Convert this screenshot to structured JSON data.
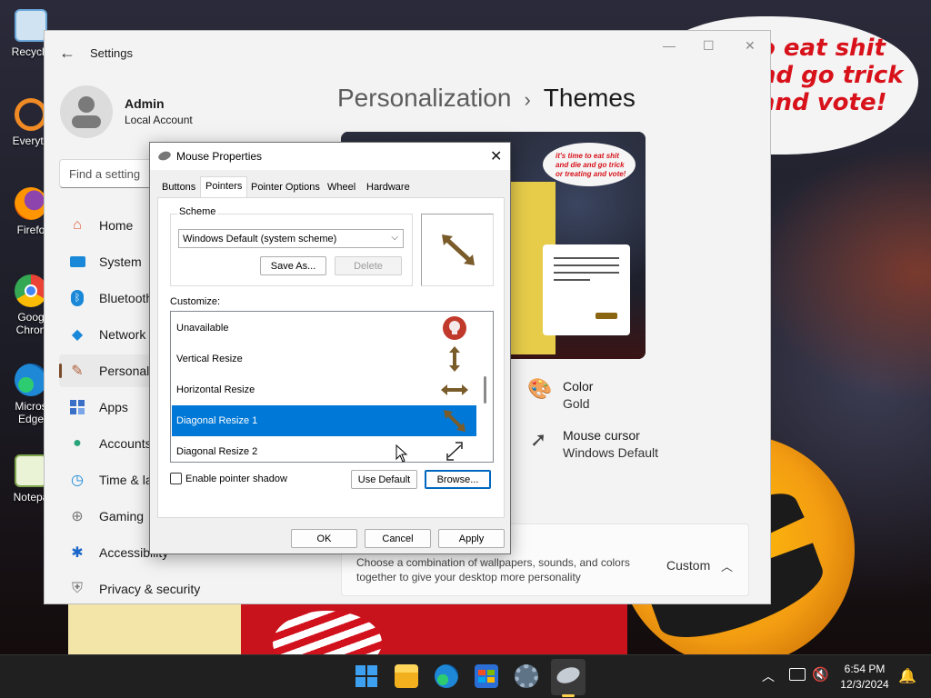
{
  "desktop": {
    "speech_bubble_text": "o eat shit\nnd go trick\nand vote!",
    "icons": [
      {
        "label": "Recycle",
        "name": "recycle-bin-icon",
        "color": "#6aa6d8"
      },
      {
        "label": "Everyth",
        "name": "everything-search-icon",
        "color": "#f08a24"
      },
      {
        "label": "Firefo",
        "name": "firefox-icon",
        "color": "#e66000"
      },
      {
        "label": "Goog\nChron",
        "name": "google-chrome-icon",
        "color": "#34a853"
      },
      {
        "label": "Micros\nEdge",
        "name": "microsoft-edge-icon",
        "color": "#1e88d6"
      },
      {
        "label": "Notepa",
        "name": "notepad-icon",
        "color": "#b8d68c"
      }
    ]
  },
  "settings": {
    "title": "Settings",
    "profile": {
      "name": "Admin",
      "type": "Local Account"
    },
    "search_placeholder": "Find a setting",
    "nav": [
      {
        "label": "Home",
        "icon": "home-icon",
        "color": "#e06040"
      },
      {
        "label": "System",
        "icon": "system-icon",
        "color": "#1a88d8"
      },
      {
        "label": "Bluetooth",
        "icon": "bluetooth-icon",
        "color": "#1a88d8"
      },
      {
        "label": "Network",
        "icon": "network-icon",
        "color": "#1a88d8"
      },
      {
        "label": "Personali",
        "icon": "personalization-icon",
        "color": "#b0623a"
      },
      {
        "label": "Apps",
        "icon": "apps-icon",
        "color": "#3a6fc8"
      },
      {
        "label": "Accounts",
        "icon": "accounts-icon",
        "color": "#2aa37a"
      },
      {
        "label": "Time & la",
        "icon": "time-language-icon",
        "color": "#1a88d8"
      },
      {
        "label": "Gaming",
        "icon": "gaming-icon",
        "color": "#7a7a7a"
      },
      {
        "label": "Accessibility",
        "icon": "accessibility-icon",
        "color": "#1a66c8"
      },
      {
        "label": "Privacy & security",
        "icon": "privacy-shield-icon",
        "color": "#7a7a7a"
      }
    ],
    "breadcrumb": {
      "parent": "Personalization",
      "separator": "›",
      "current": "Themes"
    },
    "preview_bubble_text": "it's time to eat shit\nand die and go trick\nor treating and vote!",
    "color": {
      "label": "Color",
      "value": "Gold"
    },
    "mouse_cursor": {
      "label": "Mouse cursor",
      "value": "Windows Default"
    },
    "current_theme": {
      "description": "Choose a combination of wallpapers, sounds, and colors together to give your desktop more personality",
      "value": "Custom"
    }
  },
  "dialog": {
    "title": "Mouse Properties",
    "close_label": "✕",
    "tabs": [
      "Buttons",
      "Pointers",
      "Pointer Options",
      "Wheel",
      "Hardware"
    ],
    "active_tab": "Pointers",
    "scheme_label": "Scheme",
    "scheme_value": "Windows Default (system scheme)",
    "save_as_label": "Save As...",
    "delete_label": "Delete",
    "customize_label": "Customize:",
    "cursors": [
      {
        "label": "Unavailable",
        "icon": "unavailable-cursor-icon"
      },
      {
        "label": "Vertical Resize",
        "icon": "vertical-resize-cursor-icon"
      },
      {
        "label": "Horizontal Resize",
        "icon": "horizontal-resize-cursor-icon"
      },
      {
        "label": "Diagonal Resize 1",
        "icon": "diagonal-resize-1-cursor-icon"
      },
      {
        "label": "Diagonal Resize 2",
        "icon": "diagonal-resize-2-cursor-icon"
      }
    ],
    "selected_cursor": "Diagonal Resize 1",
    "shadow_label": "Enable pointer shadow",
    "use_default_label": "Use Default",
    "browse_label": "Browse...",
    "ok_label": "OK",
    "cancel_label": "Cancel",
    "apply_label": "Apply"
  },
  "taskbar": {
    "time": "6:54 PM",
    "date": "12/3/2024",
    "apps": [
      "start-icon",
      "file-explorer-icon",
      "edge-icon",
      "store-icon",
      "settings-icon",
      "mouse-properties-icon"
    ]
  },
  "colors": {
    "accent": "#0078d7",
    "selected_nav": "#7a4b2a",
    "pumpkin": "#f39c12",
    "taskbar": "#202020"
  }
}
